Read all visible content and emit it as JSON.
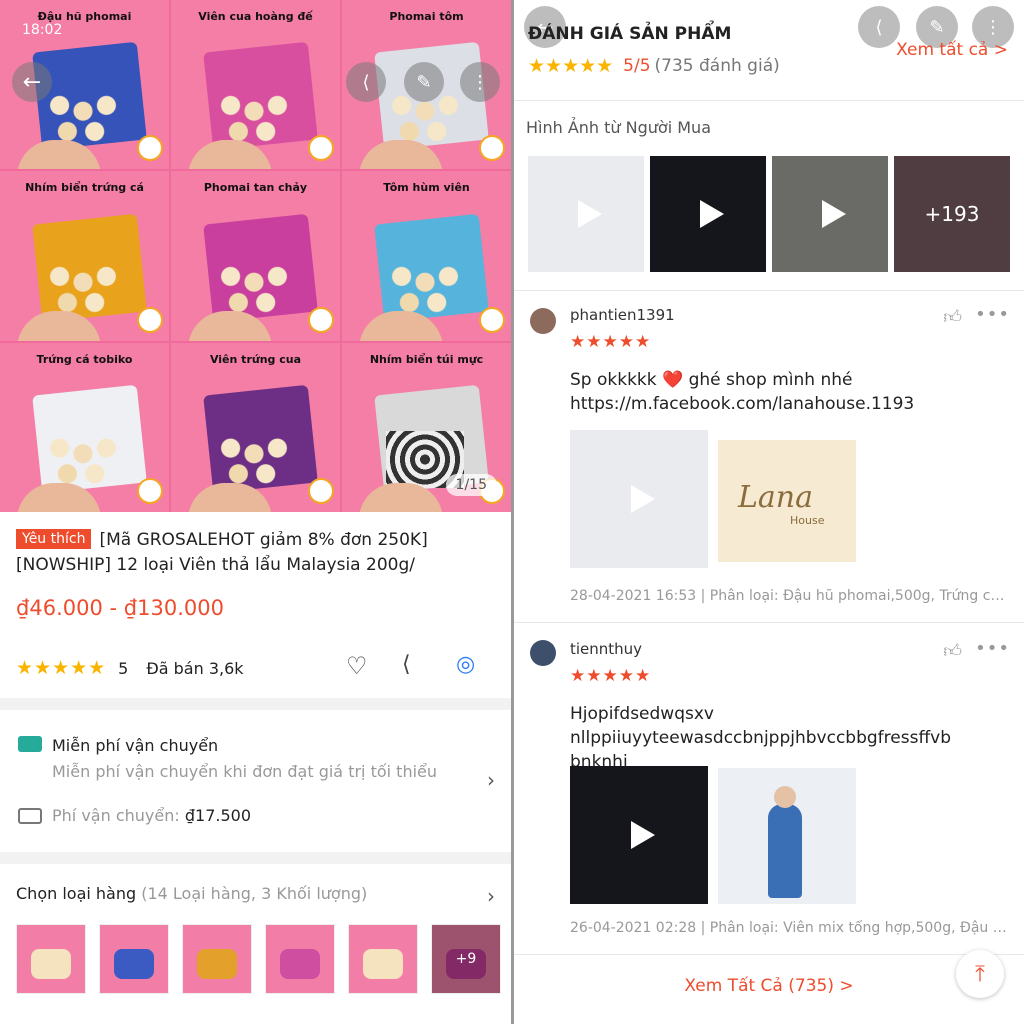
{
  "left": {
    "status_time": "18:02",
    "gallery_captions": [
      "Đậu hũ phomai",
      "Viên cua hoàng đế",
      "Phomai tôm",
      "Nhím biển trứng cá",
      "Phomai tan chảy",
      "Tôm hùm viên",
      "Trứng cá tobiko",
      "Viên trứng cua",
      "Nhím biển túi mực"
    ],
    "image_counter": "1/15",
    "favorite_badge": "Yêu thích",
    "product_title": "[Mã GROSALEHOT giảm 8% đơn 250K] [NOWSHIP] 12 loại Viên thả lẩu Malaysia 200g/",
    "price_range": "₫46.000 - ₫130.000",
    "rating_stars": "★★★★★",
    "rating_value": "5",
    "sold": "Đã bán 3,6k",
    "free_ship_title": "Miễn phí vận chuyển",
    "free_ship_sub": "Miễn phí vận chuyển khi đơn đạt giá trị tối thiểu",
    "ship_fee_label": "Phí vận chuyển:",
    "ship_fee_value": "₫17.500",
    "variant_label": "Chọn loại hàng",
    "variant_count": "(14 Loại hàng, 3 Khối lượng)",
    "variant_more": "+9"
  },
  "right": {
    "section_title": "ĐÁNH GIÁ SẢN PHẨM",
    "see_all_top": "Xem tất cả >",
    "overall_stars": "★★★★★",
    "overall_score": "5/5",
    "overall_count": "(735 đánh giá)",
    "buyer_photos_label": "Hình Ảnh từ Người Mua",
    "more_media": "+193",
    "reviews": [
      {
        "user": "phantien1391",
        "stars": "★★★★★",
        "comment": "Sp okkkkk ❤️ ghé shop mình nhé https://m.facebook.com/lanahouse.1193",
        "meta": "28-04-2021 16:53 | Phân loại: Đậu hũ phomai,500g, Trứng cá to...",
        "lana_title": "Lana",
        "lana_sub": "House"
      },
      {
        "user": "tiennthuy",
        "stars": "★★★★★",
        "comment": "Hjopifdsedwqsxv nllppiiuyyteewasdccbnjppjhbvccbbgfressffvb bnknhj",
        "meta": "26-04-2021 02:28 | Phân loại: Viên mix tổng hợp,500g, Đậu hũ p..."
      }
    ],
    "see_all_bottom": "Xem Tất Cả (735) >"
  }
}
